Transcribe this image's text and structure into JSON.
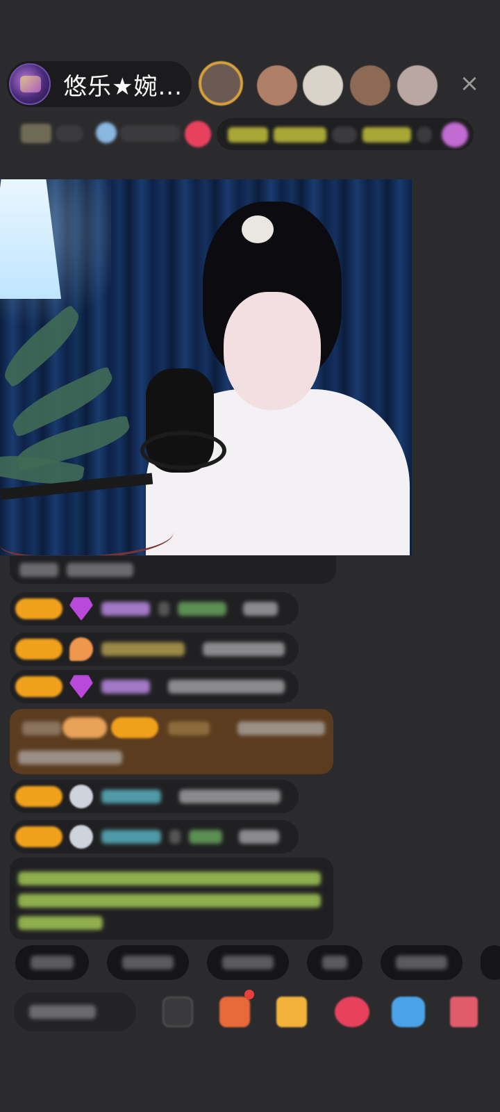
{
  "header": {
    "host_name": "悠乐★婉...",
    "close_icon": "×"
  },
  "viewers": [
    "viewer-1",
    "viewer-2",
    "viewer-3",
    "viewer-4",
    "viewer-5"
  ],
  "colors": {
    "background": "#2b2b2d",
    "badge_orange": "#f0a11c",
    "highlight_green": "#a9c63f",
    "gift_bar": "#5b3c1e",
    "notification_red": "#e8413b"
  },
  "chat_messages": [
    "msg-1",
    "msg-2",
    "msg-3",
    "msg-4",
    "msg-5",
    "msg-6",
    "msg-7",
    "msg-8",
    "msg-9"
  ],
  "quick_replies": [
    "reply-1",
    "reply-2",
    "reply-3",
    "reply-4",
    "reply-5"
  ],
  "toolbar_icons": [
    "more-icon",
    "gift-box-icon",
    "gift-icon",
    "heart-gift-icon",
    "game-icon",
    "red-packet-icon"
  ]
}
